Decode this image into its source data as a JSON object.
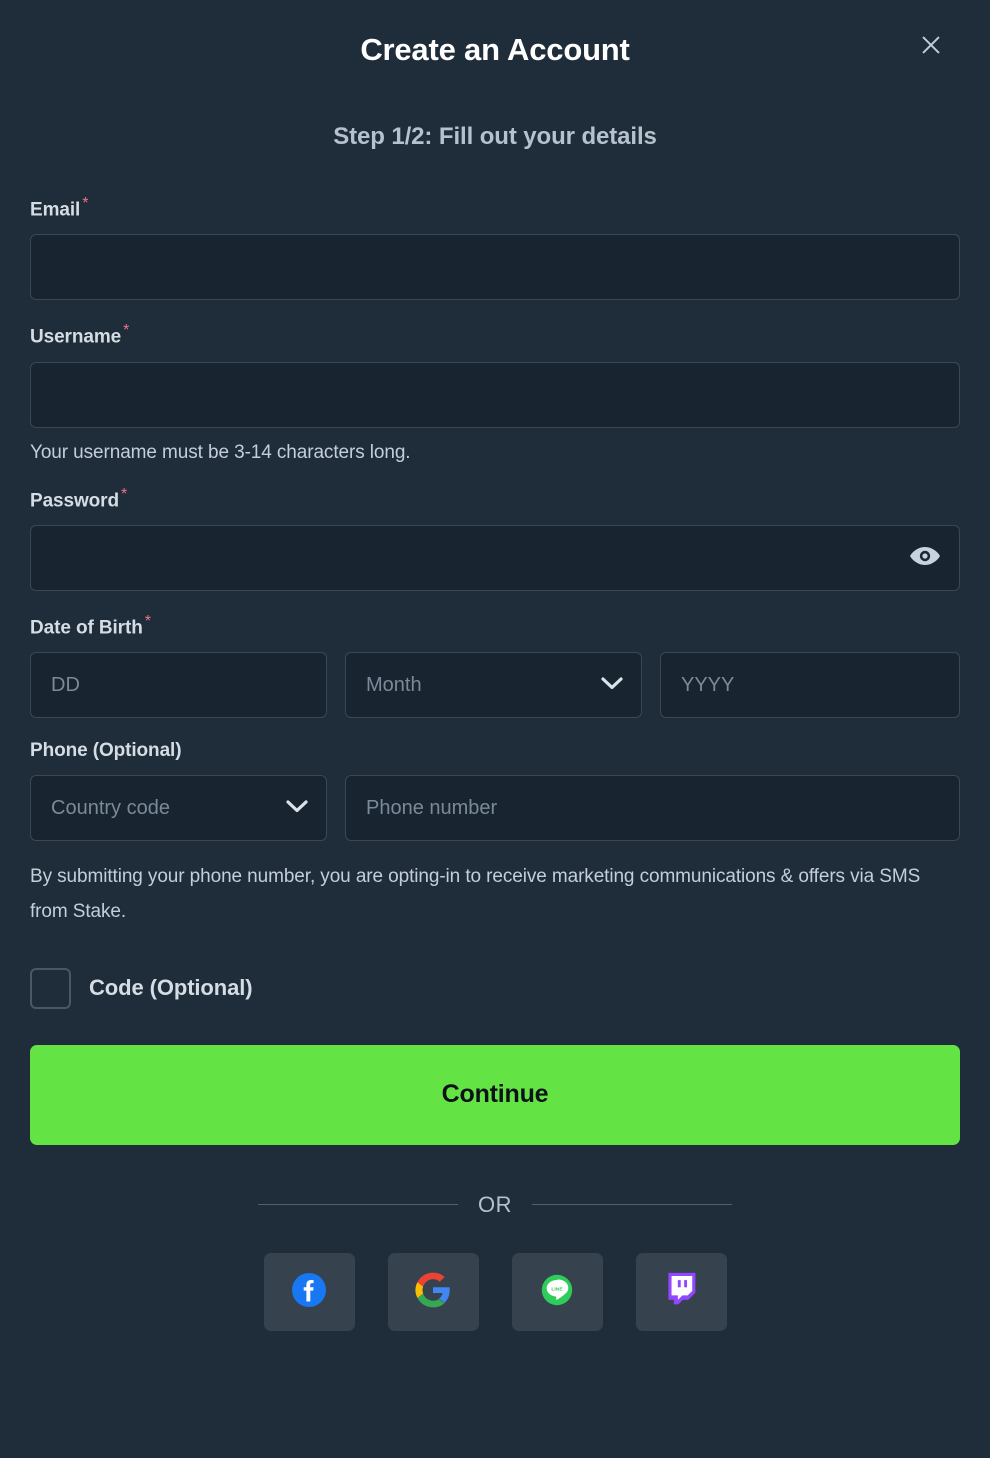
{
  "modal": {
    "title": "Create an Account",
    "close_icon": "close-icon",
    "step_text": "Step 1/2: Fill out your details"
  },
  "form": {
    "email": {
      "label": "Email",
      "required_mark": "*",
      "value": "",
      "placeholder": ""
    },
    "username": {
      "label": "Username",
      "required_mark": "*",
      "value": "",
      "placeholder": "",
      "helper": "Your username must be 3-14 characters long."
    },
    "password": {
      "label": "Password",
      "required_mark": "*",
      "value": "",
      "placeholder": "",
      "toggle_icon": "eye-icon"
    },
    "date_of_birth": {
      "label": "Date of Birth",
      "required_mark": "*",
      "day_placeholder": "DD",
      "day_value": "",
      "month_selected": "Month",
      "month_chevron_icon": "chevron-down-icon",
      "year_placeholder": "YYYY",
      "year_value": ""
    },
    "phone": {
      "label": "Phone (Optional)",
      "country_code_selected": "Country code",
      "country_code_chevron_icon": "chevron-down-icon",
      "number_placeholder": "Phone number",
      "number_value": "",
      "disclaimer": "By submitting your phone number, you are opting-in to receive marketing communications & offers via SMS from Stake."
    },
    "code": {
      "label": "Code (Optional)",
      "checked": false
    },
    "submit_label": "Continue"
  },
  "divider": {
    "text": "OR"
  },
  "social_logins": [
    {
      "name": "facebook",
      "label": "Facebook",
      "color": "#1877F2"
    },
    {
      "name": "google",
      "label": "Google",
      "color": "#4285F4"
    },
    {
      "name": "line",
      "label": "LINE",
      "color": "#06C755"
    },
    {
      "name": "twitch",
      "label": "Twitch",
      "color": "#9146FF"
    }
  ],
  "colors": {
    "page_background": "#1f2c3a",
    "input_background": "#182430",
    "input_border": "#3b4854",
    "accent_green": "#64e345",
    "required_asterisk": "#f2718b",
    "social_tile": "#36424e"
  }
}
